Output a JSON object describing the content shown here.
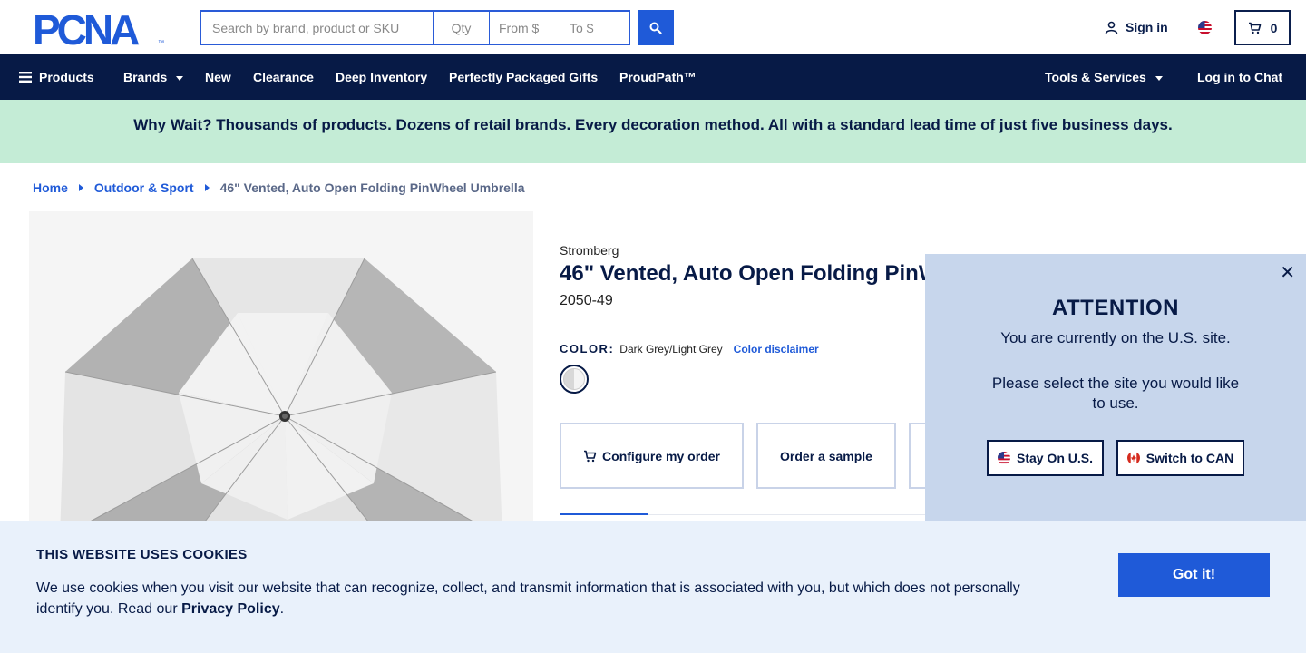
{
  "header": {
    "logo_text": "PCNA",
    "search_placeholder": "Search by brand, product or SKU",
    "qty_placeholder": "Qty",
    "from_placeholder": "From $",
    "to_placeholder": "To $",
    "sign_in": "Sign in",
    "cart_count": "0"
  },
  "nav": {
    "products": "Products",
    "brands": "Brands",
    "new": "New",
    "clearance": "Clearance",
    "deep_inventory": "Deep Inventory",
    "gifts": "Perfectly Packaged Gifts",
    "proudpath": "ProudPath™",
    "tools": "Tools & Services",
    "chat": "Log in to Chat"
  },
  "promo": {
    "text": "Why Wait? Thousands of products. Dozens of retail brands. Every decoration method. All with a standard lead time of just five business days."
  },
  "breadcrumb": {
    "home": "Home",
    "category": "Outdoor & Sport",
    "current": "46\" Vented, Auto Open Folding PinWheel Umbrella"
  },
  "product": {
    "brand": "Stromberg",
    "title": "46\" Vented, Auto Open Folding PinW",
    "sku": "2050-49",
    "color_label": "COLOR:",
    "color_value": "Dark Grey/Light Grey",
    "color_disclaimer": "Color disclaimer",
    "configure_label": "Configure my order",
    "sample_label": "Order a sample"
  },
  "attention": {
    "title": "ATTENTION",
    "line1": "You are currently on the U.S. site.",
    "line2": "Please select the site you would like to use.",
    "stay_label": "Stay On U.S.",
    "switch_label": "Switch to CAN"
  },
  "cookie": {
    "title": "THIS WEBSITE USES COOKIES",
    "text_before": "We use cookies when you visit our website that can recognize, collect, and transmit information that is associated with you, but which does not personally identify you. Read our ",
    "privacy_link": "Privacy Policy",
    "text_after": ".",
    "button": "Got it!"
  },
  "colors": {
    "navy": "#071a46",
    "blue": "#1f5ad8",
    "promo_bg": "#c4ecd6",
    "modal_bg": "#c7d6ec",
    "cookie_bg": "#e9f1fb"
  },
  "icons": [
    "menu-icon",
    "search-icon",
    "user-icon",
    "us-flag-icon",
    "cart-icon",
    "close-icon",
    "canada-flag-icon"
  ]
}
